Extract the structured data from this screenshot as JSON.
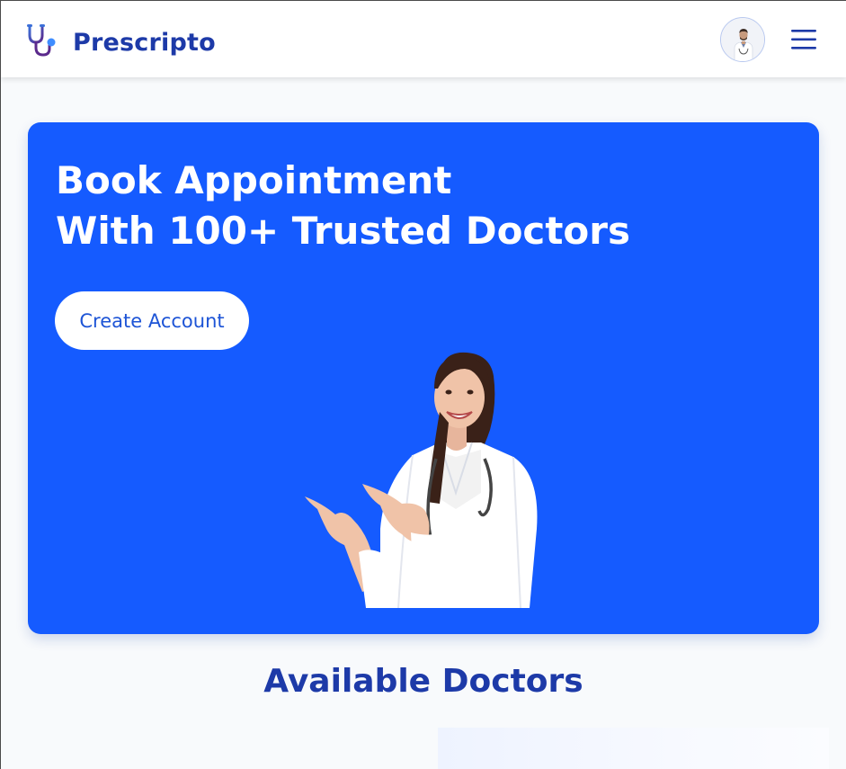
{
  "header": {
    "brand_name": "Prescripto",
    "logo_icon": "stethoscope-icon",
    "avatar_icon": "doctor-avatar",
    "menu_icon": "hamburger-menu-icon"
  },
  "hero": {
    "title_line1": "Book Appointment",
    "title_line2": "With 100+ Trusted Doctors",
    "cta_label": "Create Account",
    "illustration": "female-doctor-pointing"
  },
  "doctors_section": {
    "title": "Available Doctors"
  },
  "colors": {
    "brand": "#1d3aa8",
    "hero_bg": "#155bff",
    "cta_text": "#1d54d6",
    "page_bg": "#f8fafc"
  }
}
